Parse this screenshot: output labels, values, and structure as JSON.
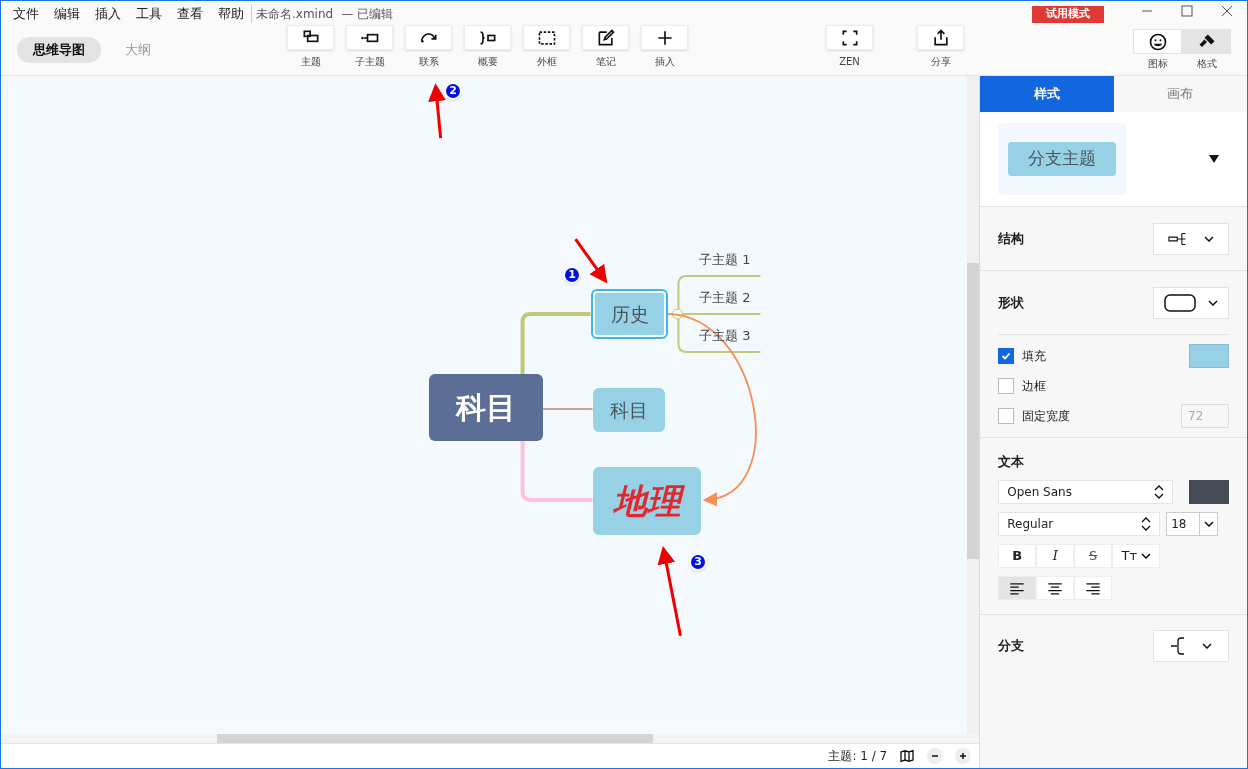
{
  "menu": [
    "文件",
    "编辑",
    "插入",
    "工具",
    "查看",
    "帮助"
  ],
  "document": {
    "name": "未命名.xmind",
    "status": "— 已编辑"
  },
  "trial_badge": "试用模式",
  "view_tabs": [
    {
      "label": "思维导图",
      "selected": true
    },
    {
      "label": "大纲",
      "selected": false
    }
  ],
  "toolbar": [
    {
      "kind": "topic",
      "label": "主题"
    },
    {
      "kind": "subtopic",
      "label": "子主题"
    },
    {
      "kind": "relation",
      "label": "联系"
    },
    {
      "kind": "summary",
      "label": "概要"
    },
    {
      "kind": "boundary",
      "label": "外框"
    },
    {
      "kind": "note",
      "label": "笔记"
    },
    {
      "kind": "insert",
      "label": "插入"
    }
  ],
  "toolbar_right": [
    {
      "kind": "zen",
      "label": "ZEN"
    },
    {
      "kind": "share",
      "label": "分享"
    }
  ],
  "panel_toggle": [
    {
      "kind": "icon",
      "label": "图标",
      "selected": false
    },
    {
      "kind": "format",
      "label": "格式",
      "selected": true
    }
  ],
  "map": {
    "nodes": [
      {
        "kind": "central",
        "text": "科目",
        "selected": false
      },
      {
        "kind": "branch",
        "text": "历史",
        "selected": true
      },
      {
        "kind": "branch",
        "text": "科目",
        "selected": false
      },
      {
        "kind": "styled",
        "text": "地理",
        "selected": false
      }
    ],
    "subtopics": [
      "子主题 1",
      "子主题 2",
      "子主题 3"
    ],
    "callouts": [
      "1",
      "2",
      "3"
    ]
  },
  "status_bar": {
    "topics": "主题: 1 / 7"
  },
  "format_panel": {
    "tabs": [
      {
        "label": "样式",
        "selected": true
      },
      {
        "label": "画布",
        "selected": false
      }
    ],
    "preview": "分支主题",
    "structure_label": "结构",
    "shape_label": "形状",
    "options": [
      {
        "label": "填充",
        "checked": true,
        "color": "#96d1e6"
      },
      {
        "label": "边框",
        "checked": false
      },
      {
        "label": "固定宽度",
        "checked": false,
        "value": "72"
      }
    ],
    "text_section": "文本",
    "font": "Open Sans",
    "text_color": {
      "color": "#454c55"
    },
    "weight": "Regular",
    "size": "18",
    "styles": [
      {
        "kind": "bold",
        "label": "B"
      },
      {
        "kind": "italic",
        "label": "I"
      },
      {
        "kind": "strike",
        "label": "S"
      },
      {
        "kind": "case",
        "label": "Tт"
      }
    ],
    "align": [
      {
        "kind": "left",
        "selected": true
      },
      {
        "kind": "center",
        "selected": false
      },
      {
        "kind": "right",
        "selected": false
      }
    ],
    "branch_label": "分支"
  }
}
